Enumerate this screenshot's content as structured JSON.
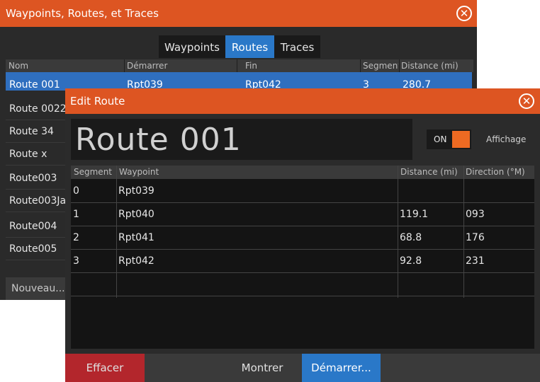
{
  "back_window": {
    "title": "Waypoints, Routes, et Traces",
    "close_icon": "close-circle-icon",
    "tabs": [
      {
        "label": "Waypoints",
        "active": false
      },
      {
        "label": "Routes",
        "active": true
      },
      {
        "label": "Traces",
        "active": false
      }
    ],
    "columns": [
      "Nom",
      "Démarrer",
      "Fin",
      "Segment",
      "Distance (mi)"
    ],
    "selected_row": {
      "nom": "Route 001",
      "demarrer": "Rpt039",
      "fin": "Rpt042",
      "segment": "3",
      "distance": "280.7"
    },
    "rows": [
      "Route 0022",
      "Route 34",
      "Route x",
      "Route003",
      "Route003Ja",
      "Route004",
      "Route005"
    ],
    "new_button": "Nouveau..."
  },
  "edit_route": {
    "title": "Edit Route",
    "close_icon": "close-circle-icon",
    "route_name": "Route 001",
    "toggle_label": "ON",
    "toggle_on": true,
    "display_label": "Affichage",
    "columns": [
      "Segment",
      "Waypoint",
      "Distance (mi)",
      "Direction (°M)"
    ],
    "rows": [
      {
        "segment": "0",
        "waypoint": "Rpt039",
        "distance": "",
        "direction": ""
      },
      {
        "segment": "1",
        "waypoint": "Rpt040",
        "distance": "119.1",
        "direction": "093"
      },
      {
        "segment": "2",
        "waypoint": "Rpt041",
        "distance": "68.8",
        "direction": "176"
      },
      {
        "segment": "3",
        "waypoint": "Rpt042",
        "distance": "92.8",
        "direction": "231"
      }
    ],
    "buttons": {
      "delete": "Effacer",
      "show": "Montrer",
      "start": "Démarrer..."
    }
  },
  "colors": {
    "title_bar": "#dd5522",
    "selection": "#2f6fbf",
    "accent_blue": "#2a78c8",
    "delete_red": "#b3262c",
    "toggle_orange": "#ee6a22"
  }
}
